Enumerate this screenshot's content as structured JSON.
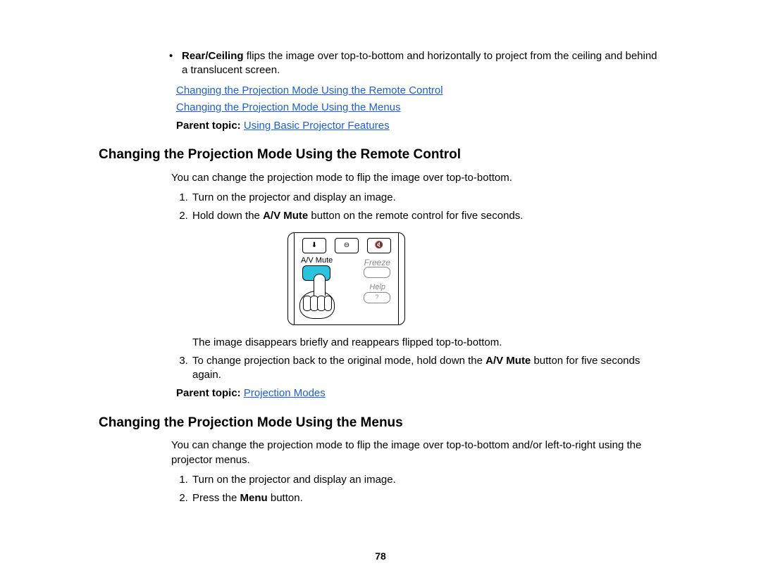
{
  "intro_bullet": {
    "bold": "Rear/Ceiling",
    "text": " flips the image over top-to-bottom and horizontally to project from the ceiling and behind a translucent screen."
  },
  "top_links": {
    "link1": "Changing the Projection Mode Using the Remote Control",
    "link2": "Changing the Projection Mode Using the Menus"
  },
  "top_parent": {
    "label": "Parent topic: ",
    "link": "Using Basic Projector Features"
  },
  "section1": {
    "heading": "Changing the Projection Mode Using the Remote Control",
    "intro": "You can change the projection mode to flip the image over top-to-bottom.",
    "step1": "Turn on the projector and display an image.",
    "step2_pre": "Hold down the ",
    "step2_bold": "A/V Mute",
    "step2_post": " button on the remote control for five seconds.",
    "after_image": "The image disappears briefly and reappears flipped top-to-bottom.",
    "step3_pre": "To change projection back to the original mode, hold down the ",
    "step3_bold": "A/V Mute",
    "step3_post": " button for five seconds again.",
    "parent_label": "Parent topic: ",
    "parent_link": "Projection Modes"
  },
  "remote": {
    "av_mute": "A/V Mute",
    "freeze": "Freeze",
    "help": "Help",
    "help_q": "?",
    "icon_down": "⬇",
    "icon_minus": "⊖",
    "icon_vol": "🔇"
  },
  "section2": {
    "heading": "Changing the Projection Mode Using the Menus",
    "intro": "You can change the projection mode to flip the image over top-to-bottom and/or left-to-right using the projector menus.",
    "step1": "Turn on the projector and display an image.",
    "step2_pre": "Press the ",
    "step2_bold": "Menu",
    "step2_post": " button."
  },
  "page_number": "78"
}
